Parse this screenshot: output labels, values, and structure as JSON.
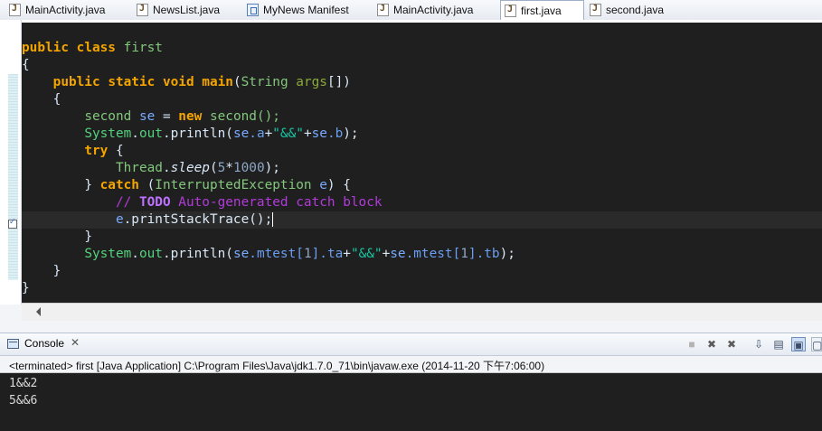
{
  "tabs": [
    {
      "label": "MainActivity.java",
      "icon": "java-file-icon"
    },
    {
      "label": "NewsList.java",
      "icon": "java-file-icon"
    },
    {
      "label": "MyNews Manifest",
      "icon": "manifest-icon"
    },
    {
      "label": "MainActivity.java",
      "icon": "java-file-icon"
    },
    {
      "label": "first.java",
      "icon": "java-file-icon",
      "active": true
    },
    {
      "label": "second.java",
      "icon": "java-file-icon"
    }
  ],
  "code": {
    "line1": {
      "kw1": "public",
      "kw2": "class",
      "name": "first"
    },
    "brace_open": "{",
    "line3": {
      "kw1": "public",
      "kw2": "static",
      "kw3": "void",
      "name": "main",
      "paren": "(",
      "type": "String",
      "arg": "args",
      "rest": "[])"
    },
    "inner_brace_open": "{",
    "line5": {
      "type": "second",
      "var": "se",
      "eq": " = ",
      "kw": "new",
      "call": " second();"
    },
    "line6": {
      "sys": "System",
      "dot": ".",
      "out": "out",
      "println": ".println(",
      "se1": "se",
      "a": ".a",
      "plus1": "+",
      "str": "\"&&\"",
      "plus2": "+",
      "se2": "se",
      "b": ".b",
      "end": ");"
    },
    "line7": {
      "kw": "try",
      "rest": " {"
    },
    "line8": {
      "type": "Thread",
      "dot": ".",
      "method": "sleep",
      "open": "(",
      "n1": "5",
      "op": "*",
      "n2": "1000",
      "close": ");"
    },
    "line9": {
      "close": "} ",
      "kw": "catch",
      "open": " (",
      "type": "InterruptedException",
      "var": " e",
      "rest": ") {"
    },
    "line10": {
      "slashes": "// ",
      "todo": "TODO",
      "rest": " Auto-generated catch block"
    },
    "line11": {
      "var": "e",
      "call": ".printStackTrace();"
    },
    "line12": "}",
    "line13": {
      "sys": "System",
      "dot": ".",
      "out": "out",
      "println": ".println(",
      "se1": "se",
      "m1": ".mtest[",
      "i1": "1",
      "t1": "].",
      "ta": "ta",
      "plus1": "+",
      "str": "\"&&\"",
      "plus2": "+",
      "se2": "se",
      "m2": ".mtest[",
      "i2": "1",
      "t2": "].",
      "tb": "tb",
      "end": ");"
    },
    "inner_brace_close": "}",
    "brace_close": "}"
  },
  "console": {
    "title": "Console",
    "close": "✕",
    "status": "<terminated> first [Java Application] C:\\Program Files\\Java\\jdk1.7.0_71\\bin\\javaw.exe (2014-11-20 下午7:06:00)",
    "output": [
      "1&&2",
      "5&&6"
    ],
    "tools": {
      "terminate": "■",
      "remove": "✖",
      "remove_all": "✖",
      "scroll_lock": "⇩",
      "pin": "▤",
      "display": "▣",
      "open": "▢"
    }
  },
  "colors": {
    "keyword": "#f4a500",
    "string": "#17c6a3",
    "variable": "#79abff",
    "comment": "#b13bd9",
    "editor_bg": "#1f1f1f"
  }
}
